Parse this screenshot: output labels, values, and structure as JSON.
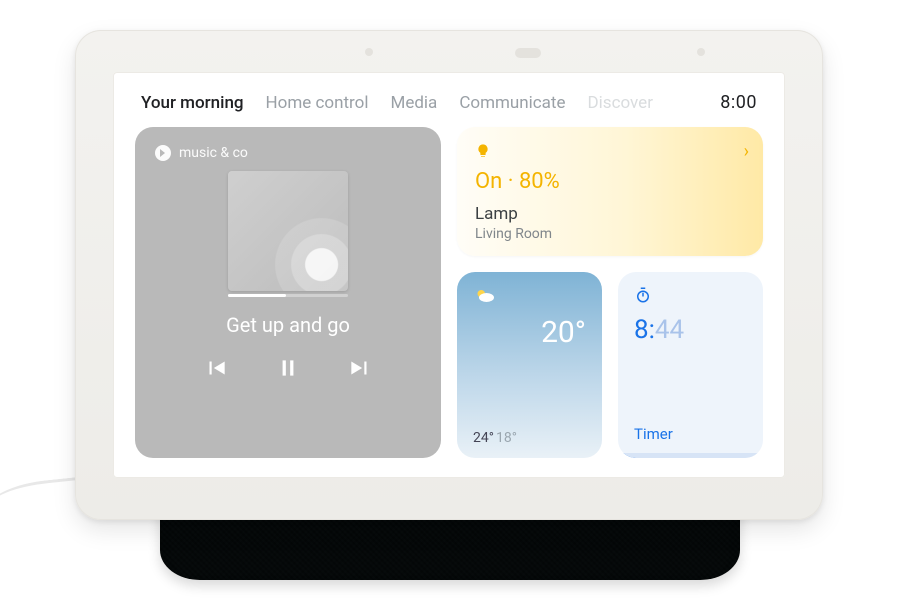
{
  "tabs": {
    "items": [
      "Your morning",
      "Home control",
      "Media",
      "Communicate",
      "Discover"
    ],
    "active_index": 0,
    "faded_index": 4
  },
  "clock": "8:00",
  "music": {
    "provider": "music & co",
    "track_title": "Get up and go",
    "progress_pct": 48
  },
  "lamp": {
    "icon": "bulb-icon",
    "state_text": "On · 80%",
    "name": "Lamp",
    "room": "Living Room"
  },
  "weather": {
    "temp": "20°",
    "high": "24°",
    "low": "18°"
  },
  "timer": {
    "value_main": "8:",
    "value_seconds": "44",
    "label": "Timer",
    "progress_pct": 62
  }
}
